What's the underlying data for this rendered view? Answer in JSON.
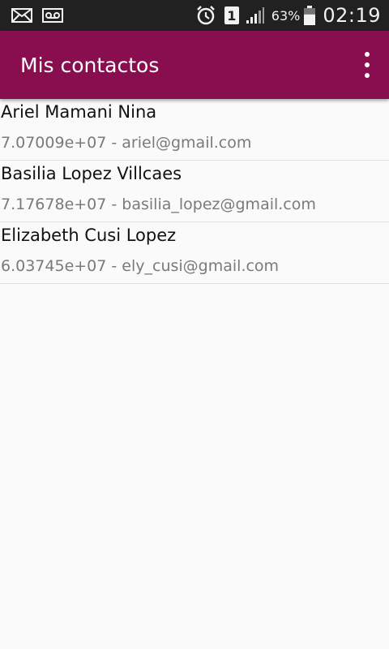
{
  "status_bar": {
    "left_icons": [
      "mail-icon",
      "voicemail-icon"
    ],
    "right_icons": [
      "alarm-icon",
      "sim-icon",
      "signal-icon",
      "battery-icon"
    ],
    "sim_label": "1",
    "battery_percent": "63%",
    "battery_level": 0.63,
    "time": "02:19"
  },
  "app_bar": {
    "title": "Mis contactos",
    "menu_icon": "overflow-menu-icon",
    "color": "#880e4f"
  },
  "contacts": [
    {
      "name": "Ariel Mamani Nina",
      "detail": "7.07009e+07 - ariel@gmail.com"
    },
    {
      "name": "Basilia Lopez Villcaes",
      "detail": "7.17678e+07 - basilia_lopez@gmail.com"
    },
    {
      "name": "Elizabeth Cusi Lopez",
      "detail": "6.03745e+07 - ely_cusi@gmail.com"
    }
  ]
}
